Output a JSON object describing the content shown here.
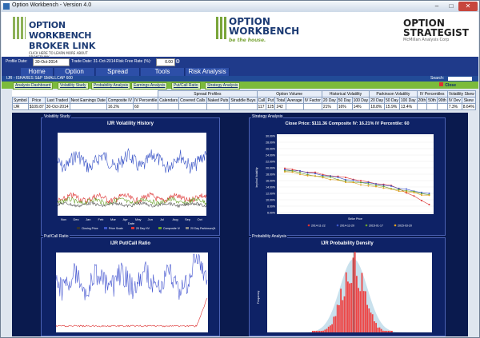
{
  "window": {
    "title": "Option Workbench - Version 4.0",
    "min": "–",
    "max": "□",
    "close": "✕"
  },
  "logos": {
    "broker_link": {
      "line1": "OPTION WORKBENCH",
      "line2": "BROKER LINK",
      "tagline": "CLICK HERE TO LEARN MORE ABOUT BROKERLINK"
    },
    "workbench": {
      "line1": "OPTION",
      "line2": "WORKBENCH",
      "tagline": "be the house."
    },
    "strategist": {
      "line1": "OPTION",
      "line2": "STRATEGIST",
      "sub": "McMillan Analysis Corp"
    }
  },
  "profile": {
    "profile_date_label": "Profile Date:",
    "profile_date_value": "30-Oct-2014",
    "trade_date_label": "Trade Date: 31-Oct-2014",
    "risk_free_label": "Risk Free Rate (%):",
    "risk_free_value": "0.00"
  },
  "menu": [
    "Home",
    "Option Profiles",
    "Spread Profiles",
    "Tools",
    "Risk Analysis"
  ],
  "symbol_bar": {
    "text": "IJR - ISHARES S&P SMALLCAP 600",
    "search_label": "Search:"
  },
  "tabs": [
    "Analysis Dashboard",
    "Volatility Study",
    "Probability Analysis",
    "Earnings Analysis",
    "Put/Call Ratio",
    "Strategy Analysis"
  ],
  "close_label": "Close",
  "quote_table": {
    "group_headers": {
      "spread": "Spread Profiles",
      "volume": "Option Volume",
      "hv": "Historical Volatility",
      "pv": "Parkinson Volatility",
      "ivp": "IV Percentiles",
      "skew": "Volatility Skew"
    },
    "headers": [
      "Symbol",
      "Price",
      "Last Traded",
      "Next Earnings Date",
      "Composite IV",
      "IV Percentile",
      "Calendars",
      "Covered Calls",
      "Naked Puts",
      "Straddle Buys",
      "Call",
      "Put",
      "Total",
      "Average",
      "IV Factor",
      "20 Day",
      "50 Day",
      "100 Day",
      "20 Day",
      "50 Day",
      "100 Day",
      "20th",
      "50th",
      "90th",
      "IV Dev",
      "Skew"
    ],
    "row": [
      "IJR",
      "$109.87",
      "30-Oct-2014",
      "",
      "16.2%",
      "60",
      "",
      "",
      "",
      "",
      "117",
      "125",
      "242",
      "",
      "",
      "21%",
      "16%",
      "14%",
      "18.8%",
      "15.9%",
      "13.4%",
      "",
      "",
      "",
      "7.3%",
      "8.64%"
    ]
  },
  "panels": {
    "vol": {
      "label": "Volatility Study",
      "title": "IJR Volatility History",
      "xlabel": "Date",
      "legend": [
        "Closing Price",
        "Price Scale",
        "20 Day HV",
        "Composite IV",
        "20 Day Parkinson(H-L)"
      ],
      "xticks": [
        "Nov",
        "Dec",
        "Jan",
        "Feb",
        "Mar",
        "Apr",
        "May",
        "Jun",
        "Jul",
        "Aug",
        "Sep",
        "Oct"
      ]
    },
    "strategy": {
      "label": "Strategy Analysis",
      "title": "Close Price: $111.36 Composite IV: 16.21% IV Percentile: 60",
      "xlabel": "Strike Price",
      "ylabel": "Implied Volatility",
      "legend": [
        "2014-11-22",
        "2014-12-20",
        "2015-01-17",
        "2015-03-20"
      ],
      "yticks": [
        "30.00%",
        "28.00%",
        "26.00%",
        "24.00%",
        "22.00%",
        "20.00%",
        "18.00%",
        "16.00%",
        "14.00%",
        "12.00%",
        "10.00%",
        "8.00%",
        "6.00%"
      ]
    },
    "pcr": {
      "label": "Put/Call Ratio",
      "title": "IJR Put/Call Ratio"
    },
    "prob": {
      "label": "Probability Analysis",
      "title": "IJR Probability Density",
      "ylabel": "Frequency"
    }
  },
  "colors": {
    "navy": "#1f3a8a",
    "green": "#7cbb3b",
    "accent": "#2d4fa8"
  }
}
